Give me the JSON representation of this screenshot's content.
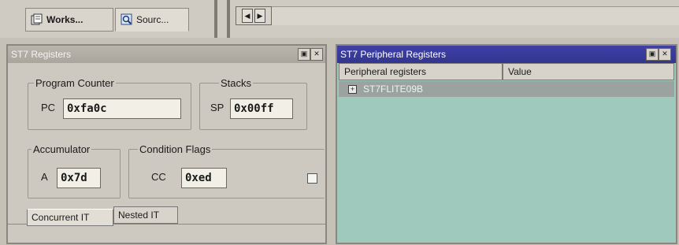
{
  "toolbar": {
    "tabs": [
      {
        "label": "Works...",
        "icon": "workspace-icon"
      },
      {
        "label": "Sourc...",
        "icon": "source-icon"
      }
    ],
    "nav_left_icon": "scroll-left-icon",
    "nav_right_icon": "scroll-right-icon"
  },
  "registers_window": {
    "title": "ST7 Registers",
    "program_counter": {
      "group_label": "Program Counter",
      "reg_label": "PC",
      "value": "0xfa0c"
    },
    "stacks": {
      "group_label": "Stacks",
      "reg_label": "SP",
      "value": "0x00ff"
    },
    "accumulator": {
      "group_label": "Accumulator",
      "reg_label": "A",
      "value": "0x7d"
    },
    "condition_flags": {
      "group_label": "Condition Flags",
      "reg_label": "CC",
      "value": "0xed"
    },
    "tabs": [
      "Concurrent IT",
      "Nested IT"
    ]
  },
  "peripheral_window": {
    "title": "ST7 Peripheral Registers",
    "columns": [
      "Peripheral registers",
      "Value"
    ],
    "rows": [
      {
        "label": "ST7FLITE09B",
        "expander": "+"
      }
    ]
  },
  "colors": {
    "panel_bg": "#cdc9c0",
    "active_title": "#3f40a6",
    "inactive_title": "#b9b5ad",
    "peripheral_bg": "#9fc9bd"
  }
}
